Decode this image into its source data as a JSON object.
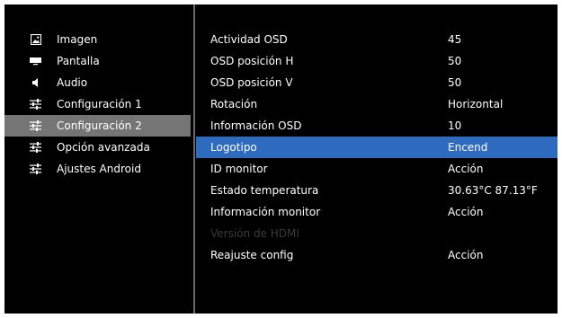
{
  "sidebar": {
    "items": [
      {
        "label": "Imagen",
        "icon": "image-icon"
      },
      {
        "label": "Pantalla",
        "icon": "screen-icon"
      },
      {
        "label": "Audio",
        "icon": "speaker-icon"
      },
      {
        "label": "Configuración 1",
        "icon": "sliders-icon"
      },
      {
        "label": "Configuración 2",
        "icon": "sliders-icon",
        "selected": true
      },
      {
        "label": "Opción avanzada",
        "icon": "sliders-icon"
      },
      {
        "label": "Ajustes Android",
        "icon": "sliders-icon"
      }
    ]
  },
  "settings": {
    "rows": [
      {
        "label": "Actividad OSD",
        "value": "45"
      },
      {
        "label": "OSD posición H",
        "value": "50"
      },
      {
        "label": "OSD posición V",
        "value": "50"
      },
      {
        "label": "Rotación",
        "value": "Horizontal"
      },
      {
        "label": "Información OSD",
        "value": "10"
      },
      {
        "label": "Logotipo",
        "value": "Encend",
        "highlighted": true
      },
      {
        "label": "ID monitor",
        "value": "Acción"
      },
      {
        "label": "Estado temperatura",
        "value": "30.63°C 87.13°F"
      },
      {
        "label": "Información monitor",
        "value": "Acción"
      },
      {
        "label": "Versión de HDMI",
        "value": "",
        "disabled": true
      },
      {
        "label": "Reajuste config",
        "value": "Acción"
      }
    ]
  },
  "colors": {
    "background": "#000000",
    "sidebar_selected": "#757575",
    "row_highlight": "#2e6bbf",
    "text": "#ffffff",
    "text_disabled": "#3a3a3a"
  }
}
